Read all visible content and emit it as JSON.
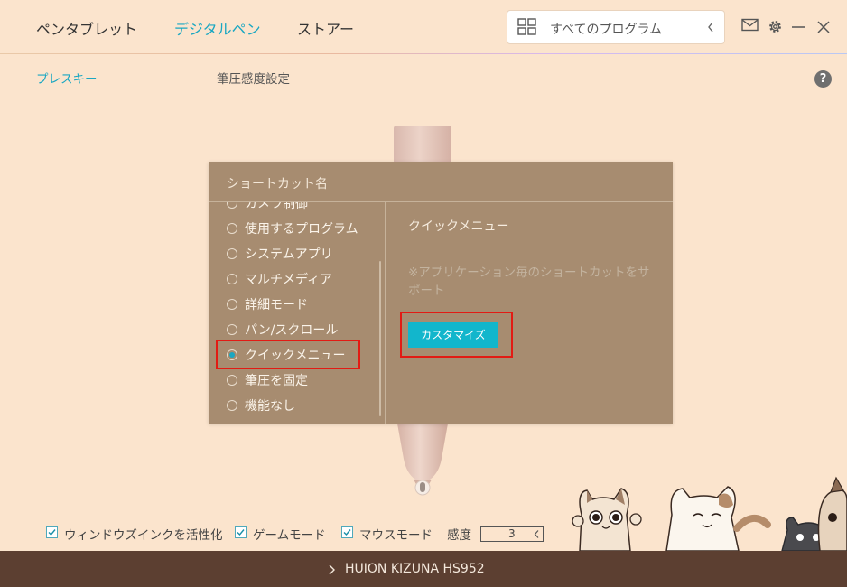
{
  "nav": {
    "tabs": [
      {
        "label": "ペンタブレット",
        "active": false
      },
      {
        "label": "デジタルペン",
        "active": true
      },
      {
        "label": "ストアー",
        "active": false
      }
    ],
    "program_select": "すべてのプログラム",
    "accent_color": "#1aa7c2"
  },
  "subnav": {
    "press_key": "プレスキー",
    "pressure": "筆圧感度設定",
    "help": "?"
  },
  "panel": {
    "title": "ショートカット名",
    "options": [
      "カメラ制御",
      "使用するプログラム",
      "システムアプリ",
      "マルチメディア",
      "詳細モード",
      "パン/スクロール",
      "クイックメニュー",
      "筆圧を固定",
      "機能なし"
    ],
    "selected": "クイックメニュー",
    "detail_title": "クイックメニュー",
    "detail_desc": "※アプリケーション毎のショートカットをサポート",
    "customize_button": "カスタマイズ"
  },
  "bottom": {
    "windows_ink": "ウィンドウズインクを活性化",
    "game_mode": "ゲームモード",
    "mouse_mode": "マウスモード",
    "sensitivity_label": "感度",
    "sensitivity_value": "3"
  },
  "footer": {
    "device": "HUION KIZUNA HS952"
  },
  "icons": [
    "grid-icon",
    "chevron-left-icon",
    "mail-icon",
    "gear-icon",
    "minimize-icon",
    "close-icon",
    "chevron-right-icon",
    "checkbox-checked-icon"
  ]
}
